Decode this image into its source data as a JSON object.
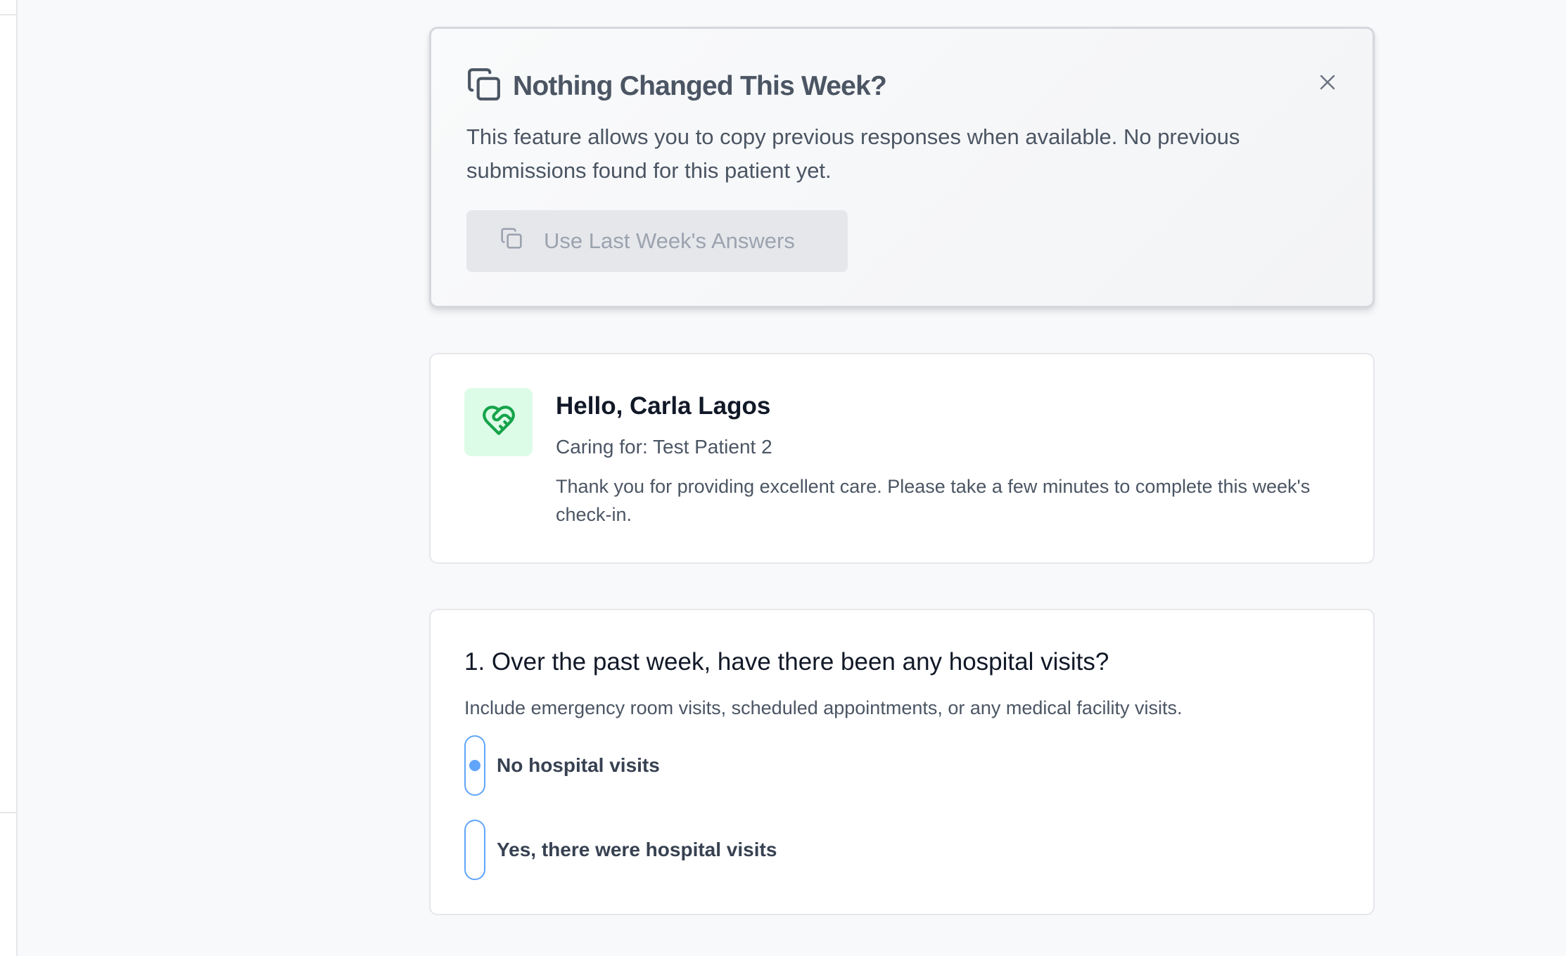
{
  "banner": {
    "title": "Nothing Changed This Week?",
    "description": "This feature allows you to copy previous responses when available. No previous submissions found for this patient yet.",
    "button_label": "Use Last Week's Answers",
    "button_disabled": true,
    "icon": "copy-icon",
    "close_icon": "close-icon"
  },
  "greeting": {
    "title": "Hello, Carla Lagos",
    "subtitle": "Caring for: Test Patient 2",
    "message": "Thank you for providing excellent care. Please take a few minutes to complete this week's check-in.",
    "icon": "heart-handshake-icon",
    "icon_color": "#16a34a",
    "icon_bg": "#dcfce7"
  },
  "question": {
    "title": "1. Over the past week, have there been any hospital visits?",
    "hint": "Include emergency room visits, scheduled appointments, or any medical facility visits.",
    "options": [
      {
        "label": "No hospital visits",
        "selected": true
      },
      {
        "label": "Yes, there were hospital visits",
        "selected": false
      }
    ],
    "accent_color": "#60a5fa"
  }
}
